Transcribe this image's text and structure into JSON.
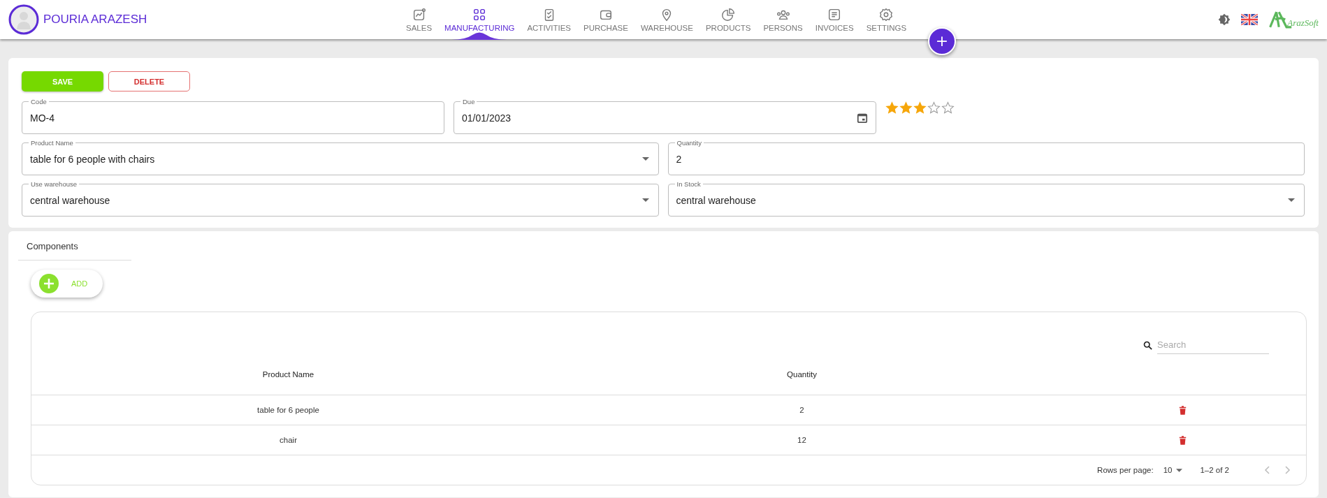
{
  "user": {
    "name": "POURIA ARAZESH"
  },
  "nav": [
    {
      "label": "SALES",
      "selected": false
    },
    {
      "label": "MANUFACTURING",
      "selected": true
    },
    {
      "label": "ACTIVITIES",
      "selected": false
    },
    {
      "label": "PURCHASE",
      "selected": false
    },
    {
      "label": "WAREHOUSE",
      "selected": false
    },
    {
      "label": "PRODUCTS",
      "selected": false
    },
    {
      "label": "PERSONS",
      "selected": false
    },
    {
      "label": "INVOICES",
      "selected": false
    },
    {
      "label": "SETTINGS",
      "selected": false
    }
  ],
  "fab": "+",
  "logo": "ArazSoft",
  "actions": {
    "save": "SAVE",
    "delete": "DELETE"
  },
  "form": {
    "rows": [
      [
        {
          "kind": "text",
          "label": "Code",
          "value": "MO-4"
        },
        {
          "kind": "date",
          "label": "Due",
          "value": "01/01/2023"
        }
      ],
      [
        {
          "kind": "select",
          "label": "Product Name",
          "value": "table for 6 people with chairs"
        },
        {
          "kind": "text",
          "label": "Quantity",
          "value": "2"
        }
      ],
      [
        {
          "kind": "select",
          "label": "Use warehouse",
          "value": "central warehouse"
        },
        {
          "kind": "select",
          "label": "In Stock",
          "value": "central warehouse"
        }
      ]
    ],
    "stars": 3
  },
  "components": {
    "title": "Components",
    "add": "ADD",
    "search": {
      "placeholder": "Search"
    },
    "columns": [
      "Product Name",
      "Quantity"
    ],
    "rows": [
      {
        "product": "table for 6 people",
        "quantity": "2"
      },
      {
        "product": "chair",
        "quantity": "12"
      }
    ],
    "pager": {
      "label": "Rows per page:",
      "per_page": "10",
      "range": "1–2 of 2",
      "prev_disabled": true,
      "next_disabled": true
    }
  }
}
